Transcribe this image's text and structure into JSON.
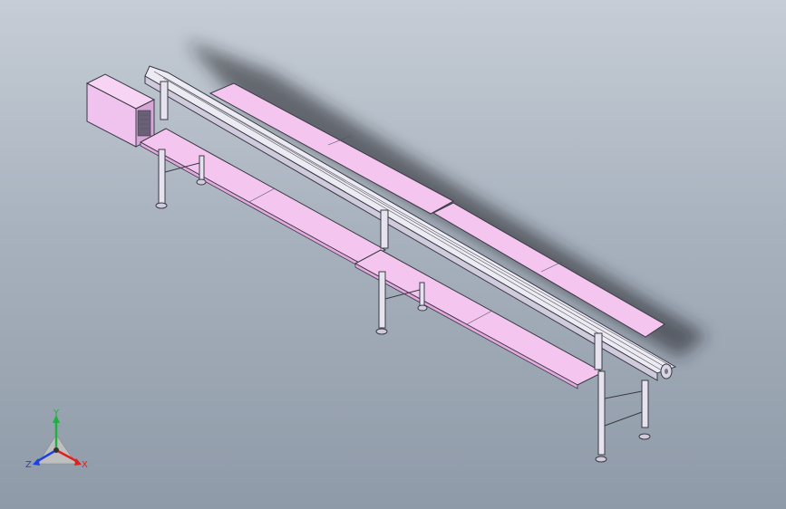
{
  "triad": {
    "x_label": "X",
    "y_label": "Y",
    "z_label": "Z",
    "x_color": "#e02020",
    "y_color": "#20b040",
    "z_color": "#2040e0"
  },
  "colors": {
    "table": "#f4c6ef",
    "table_dark": "#e3a9de",
    "frame": "#d9d6e4",
    "belt": "#eceaf2",
    "motor": "#f0c2ee"
  }
}
